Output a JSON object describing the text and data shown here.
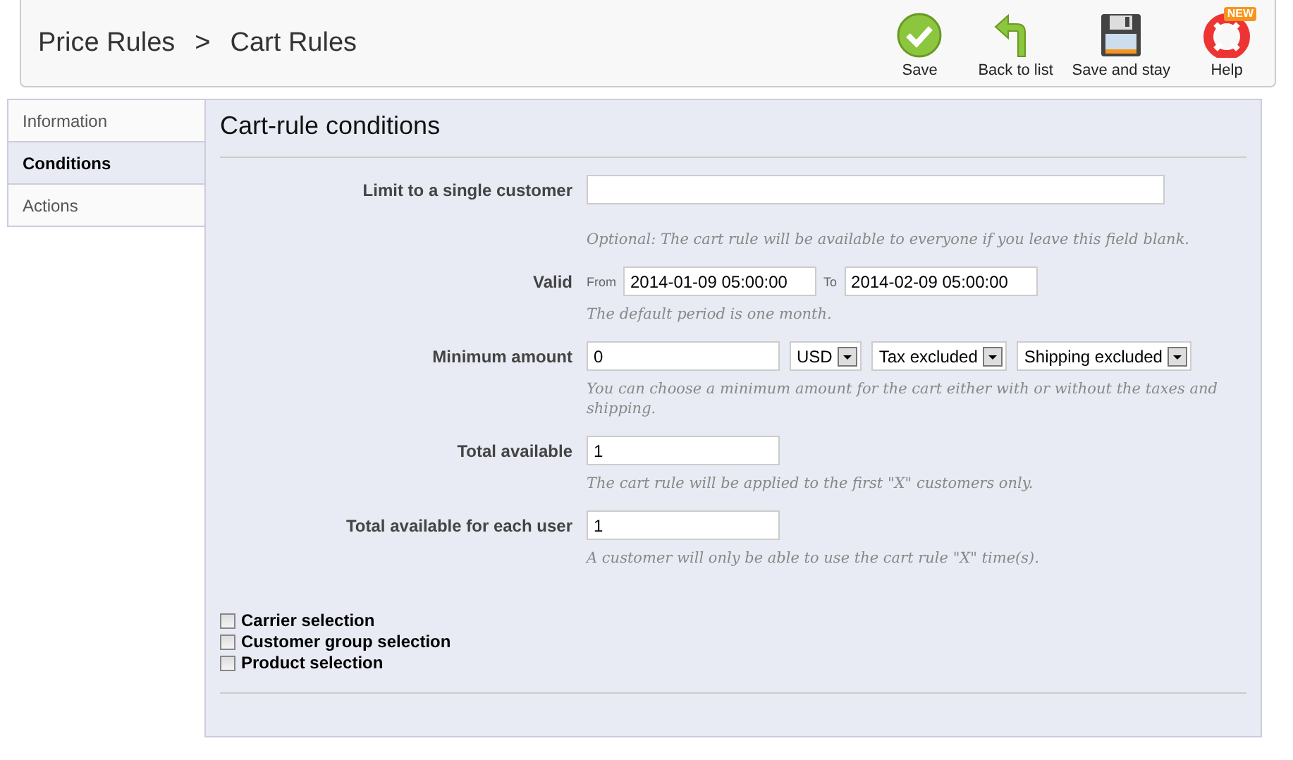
{
  "breadcrumb": {
    "items": [
      "Price Rules",
      "Cart Rules"
    ],
    "separator": ">"
  },
  "toolbar": [
    {
      "kind": "save",
      "label": "Save"
    },
    {
      "kind": "back",
      "label": "Back to list"
    },
    {
      "kind": "disk",
      "label": "Save and stay"
    },
    {
      "kind": "help",
      "label": "Help",
      "badge": "NEW"
    }
  ],
  "tabs": [
    {
      "label": "Information",
      "selected": false
    },
    {
      "label": "Conditions",
      "selected": true
    },
    {
      "label": "Actions",
      "selected": false
    }
  ],
  "panel": {
    "title": "Cart-rule conditions",
    "fields": [
      {
        "kind": "text",
        "label": "Limit to a single customer",
        "wide": true,
        "hint": "Optional: The cart rule will be available to everyone if you leave this field blank."
      },
      {
        "kind": "daterange",
        "label": "Valid",
        "from_label": "From",
        "from": "2014-01-09 05:00:00",
        "to_label": "To",
        "to": "2014-02-09 05:00:00",
        "hint": "The default period is one month."
      },
      {
        "kind": "amount",
        "label": "Minimum amount",
        "value": "0",
        "selects": [
          "USD",
          "Tax excluded",
          "Shipping excluded"
        ],
        "hint": "You can choose a minimum amount for the cart either with or without the taxes and shipping."
      },
      {
        "kind": "text",
        "label": "Total available",
        "value": "1",
        "hint": "The cart rule will be applied to the first \"X\" customers only."
      },
      {
        "kind": "text",
        "label": "Total available for each user",
        "value": "1",
        "hint": "A customer will only be able to use the cart rule \"X\" time(s)."
      }
    ],
    "checkboxes": [
      {
        "label": "Carrier selection",
        "checked": false
      },
      {
        "label": "Customer group selection",
        "checked": false
      },
      {
        "label": "Product selection",
        "checked": false
      }
    ]
  }
}
